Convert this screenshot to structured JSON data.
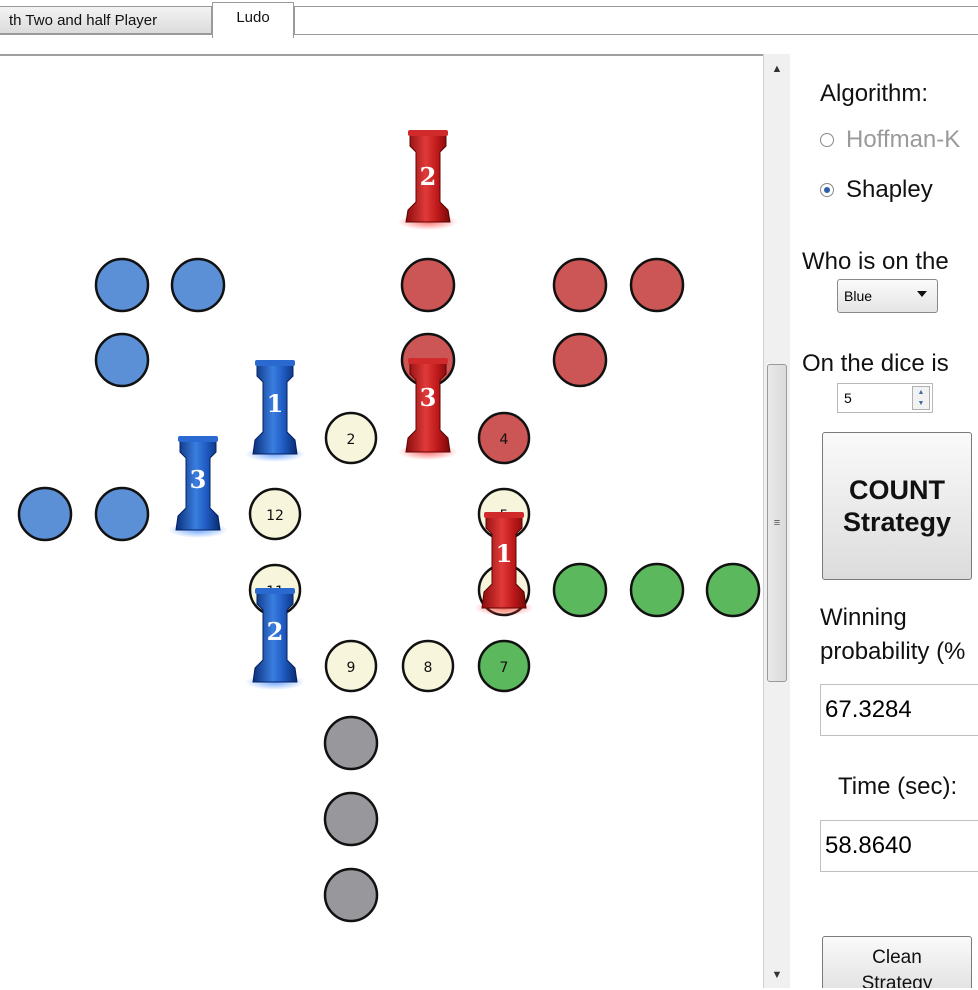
{
  "tabs": [
    {
      "label": "th Two and half Player",
      "active": false
    },
    {
      "label": "Ludo",
      "active": true
    }
  ],
  "panel": {
    "algorithm_label": "Algorithm:",
    "radio_options": [
      {
        "label": "Hoffman-K",
        "selected": false,
        "disabled": true
      },
      {
        "label": "Shapley",
        "selected": true,
        "disabled": false
      }
    ],
    "who_label": "Who is on the",
    "who_value": "Blue",
    "dice_label": "On the dice is",
    "dice_value": "5",
    "count_button": {
      "line1": "COUNT",
      "line2": "Strategy"
    },
    "winning_label_1": "Winning",
    "winning_label_2": "probability (%",
    "winning_value": "67.3284",
    "time_label": "Time (sec):",
    "time_value": "58.8640",
    "clean_button": {
      "line1": "Clean",
      "line2": "Strategy"
    }
  },
  "board": {
    "colors": {
      "blue": "#5b8fd6",
      "red": "#cc5555",
      "green": "#5cb85c",
      "gray": "#98989c",
      "cream": "#f7f5dc"
    },
    "numbered_cells": [
      "2",
      "4",
      "12",
      "5",
      "11",
      "9",
      "8",
      "7"
    ],
    "pieces": [
      {
        "color": "red",
        "label": "2"
      },
      {
        "color": "red",
        "label": "3"
      },
      {
        "color": "red",
        "label": "1"
      },
      {
        "color": "blue",
        "label": "1"
      },
      {
        "color": "blue",
        "label": "3"
      },
      {
        "color": "blue",
        "label": "2"
      }
    ]
  },
  "scrollbar": {
    "grip": "≡"
  }
}
